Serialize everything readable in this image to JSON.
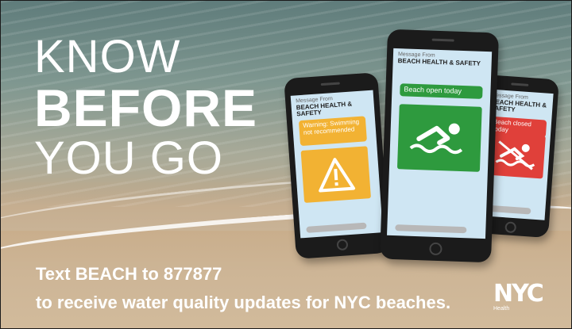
{
  "headline": {
    "line1": "KNOW",
    "line2": "BEFORE",
    "line3": "YOU GO"
  },
  "cta": {
    "line1": "Text BEACH to 877877",
    "line2": "to receive water quality updates for NYC beaches."
  },
  "logo": {
    "mark": "NYC",
    "sub": "Health"
  },
  "phones": {
    "left": {
      "from": "Message From",
      "org": "BEACH HEALTH & SAFETY",
      "alert": "Warning: Swimming not recommended",
      "color": "#f2b233"
    },
    "center": {
      "from": "Message From",
      "org": "BEACH HEALTH & SAFETY",
      "alert": "Beach open today",
      "color": "#2e9a3e"
    },
    "right": {
      "from": "Message From",
      "org": "BEACH HEALTH & SAFETY",
      "alert": "Beach closed today",
      "color": "#e0403a"
    }
  }
}
